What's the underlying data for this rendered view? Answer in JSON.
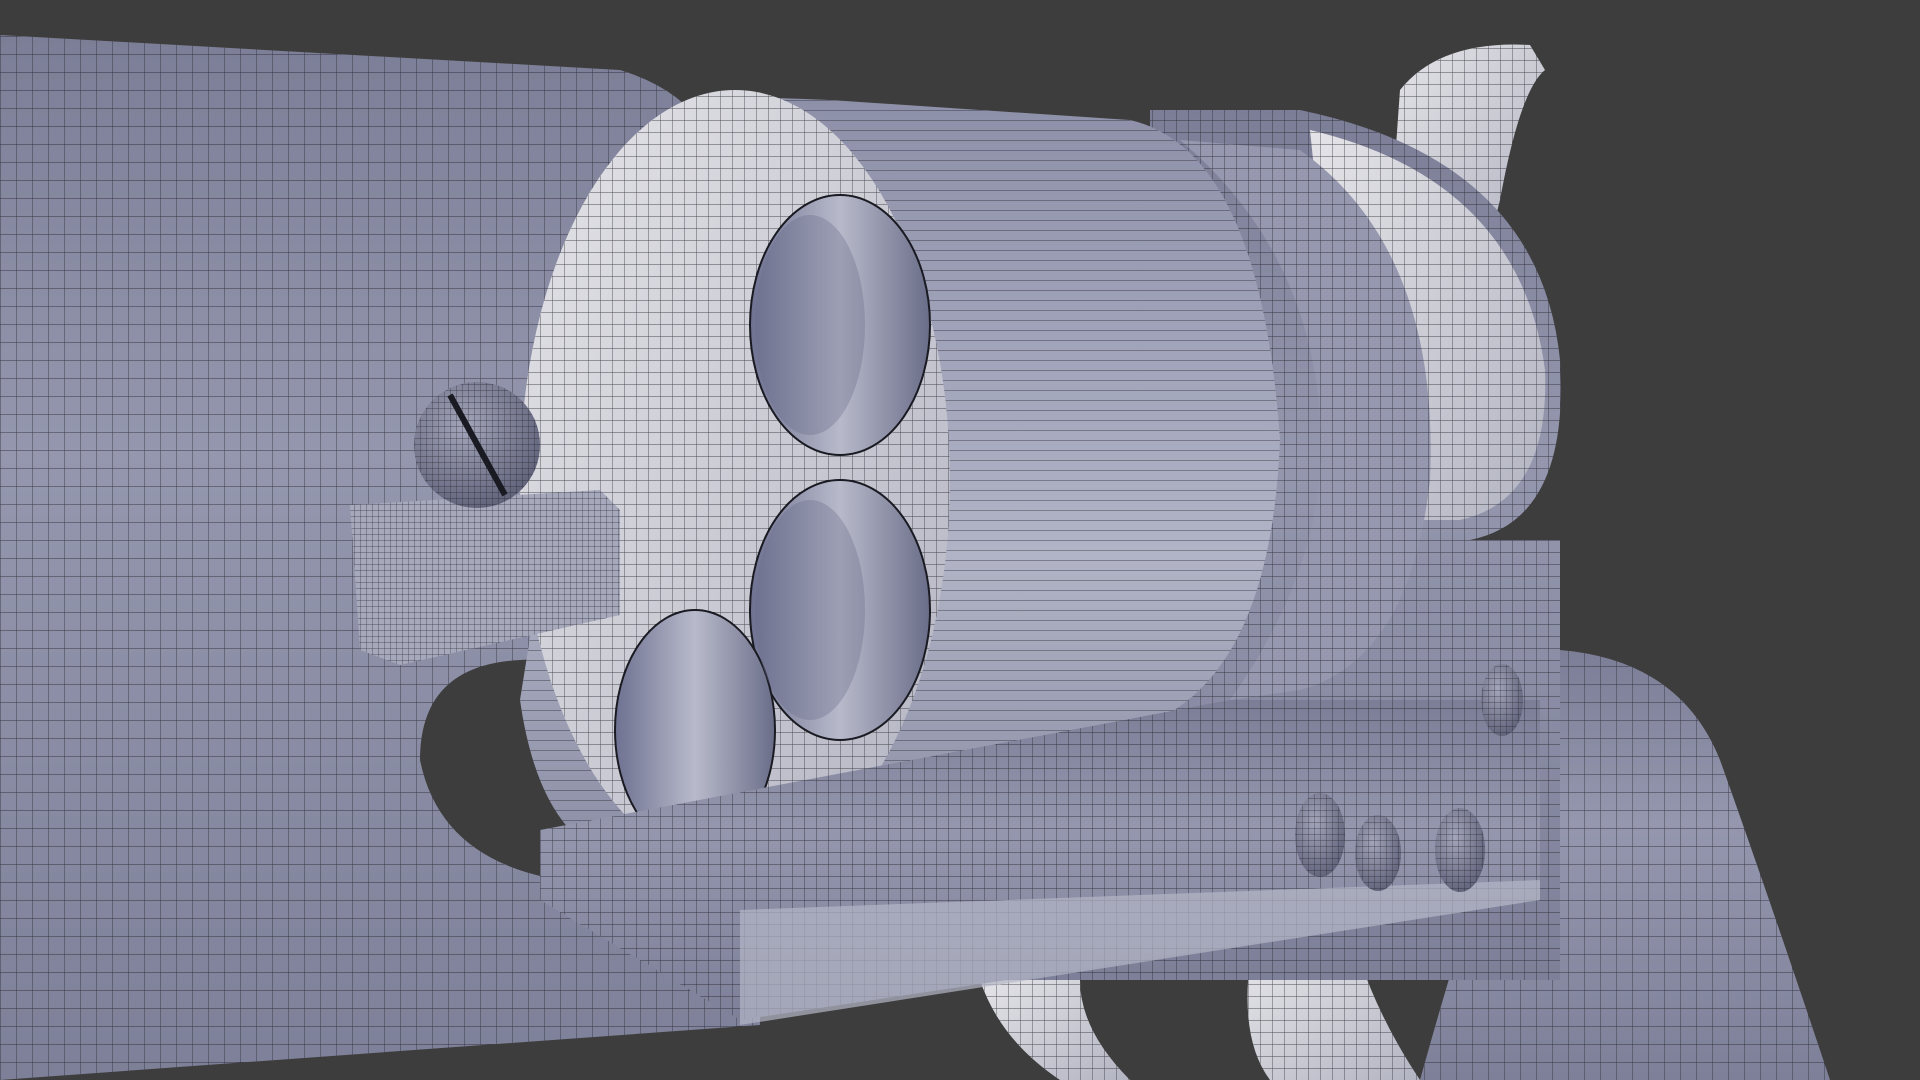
{
  "viewport": {
    "background": "#3d3d3d",
    "mesh_color": "#8f92a8",
    "mesh_light": "#c9cad3",
    "mesh_highlight": "#e2e2e6",
    "wire_color": "#1a1a22"
  },
  "scene": {
    "object": "revolver",
    "display_mode": "wireframe-on-shaded",
    "parts": [
      "barrel-housing",
      "cylinder",
      "frame",
      "hammer",
      "grip",
      "trigger-guard",
      "loading-lever",
      "screws"
    ]
  }
}
